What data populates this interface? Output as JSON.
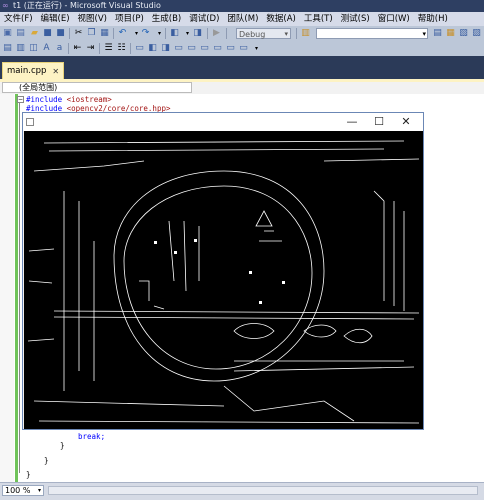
{
  "window": {
    "title": "t1 (正在运行) - Microsoft Visual Studio"
  },
  "menu": [
    "文件(F)",
    "编辑(E)",
    "视图(V)",
    "项目(P)",
    "生成(B)",
    "调试(D)",
    "团队(M)",
    "数据(A)",
    "工具(T)",
    "测试(S)",
    "窗口(W)",
    "帮助(H)"
  ],
  "toolbar": {
    "config_value": "Debug",
    "find_value": ""
  },
  "tabs": [
    {
      "label": "main.cpp"
    }
  ],
  "editor": {
    "scope_label": "(全局范围)",
    "code_top": [
      {
        "directive": "#include",
        "target": "<iostream>"
      },
      {
        "directive": "#include",
        "target": "<opencv2/core/core.hpp>"
      }
    ],
    "code_bottom": [
      {
        "text": "break;"
      },
      {
        "text": "}"
      },
      {
        "text": "}"
      },
      {
        "text": "}"
      }
    ],
    "zoom": "100 %"
  },
  "image_window": {
    "title": "",
    "controls": {
      "minimize": "—",
      "maximize": "☐",
      "close": "✕"
    }
  }
}
